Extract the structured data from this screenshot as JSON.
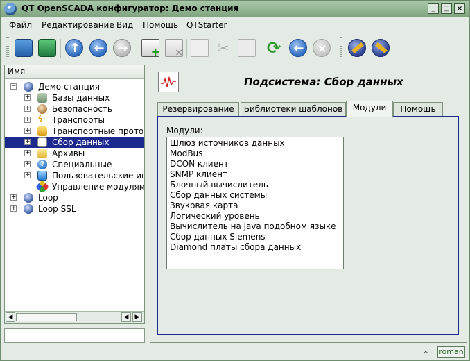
{
  "window": {
    "title": "QT OpenSCADA конфигуратор: Демо станция"
  },
  "menubar": {
    "items": [
      {
        "label": "Файл"
      },
      {
        "label": "Редактирование"
      },
      {
        "label": "Вид"
      },
      {
        "label": "Помощь"
      },
      {
        "label": "QTStarter"
      }
    ]
  },
  "toolbar": {
    "buttons": [
      {
        "icon": "db-load-icon"
      },
      {
        "icon": "db-save-icon"
      },
      {
        "icon": "up-icon"
      },
      {
        "icon": "back-icon"
      },
      {
        "icon": "forward-icon"
      },
      {
        "icon": "add-item-icon"
      },
      {
        "icon": "delete-item-icon"
      },
      {
        "icon": "copy-icon"
      },
      {
        "icon": "cut-icon"
      },
      {
        "icon": "paste-icon"
      },
      {
        "icon": "refresh-icon"
      },
      {
        "icon": "start-icon"
      },
      {
        "icon": "stop-icon"
      },
      {
        "icon": "connect-icon"
      },
      {
        "icon": "disconnect-icon"
      }
    ]
  },
  "tree": {
    "header": "Имя",
    "items": [
      {
        "label": "Демо станция",
        "expanded": true
      },
      {
        "label": "Базы данных"
      },
      {
        "label": "Безопасность"
      },
      {
        "label": "Транспорты"
      },
      {
        "label": "Транспортные протоко"
      },
      {
        "label": "Сбор данных",
        "selected": true
      },
      {
        "label": "Архивы"
      },
      {
        "label": "Специальные"
      },
      {
        "label": "Пользовательские инт"
      },
      {
        "label": "Управление модулями"
      },
      {
        "label": "Loop"
      },
      {
        "label": "Loop SSL"
      }
    ]
  },
  "content": {
    "title": "Подсистема: Сбор данных",
    "tabs": [
      {
        "label": "Резервирование"
      },
      {
        "label": "Библиотеки шаблонов"
      },
      {
        "label": "Модули",
        "active": true
      },
      {
        "label": "Помощь"
      }
    ],
    "modules_label": "Модули:",
    "modules": [
      "Шлюз источников данных",
      "ModBus",
      "DCON клиент",
      "SNMP клиент",
      "Блочный вычислитель",
      "Сбор данных системы",
      "Звуковая карта",
      "Логический уровень",
      "Вычислитель на java подобном языке",
      "Сбор данных Siemens",
      "Diamond платы сбора данных"
    ]
  },
  "statusbar": {
    "modified_mark": "*",
    "user": "roman"
  },
  "colors": {
    "selection": "#1c2a8f",
    "window_bg": "#e4ebe4",
    "titlebar": "#8fb58f"
  }
}
